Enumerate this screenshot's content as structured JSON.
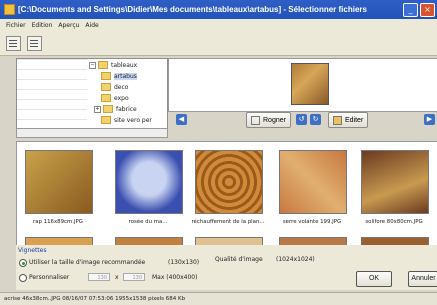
{
  "window": {
    "title": "[C:\\Documents and Settings\\Didier\\Mes documents\\tableaux\\artabus] - Sélectionner fichiers"
  },
  "menu": [
    "Fichier",
    "Edition",
    "Aperçu",
    "Aide"
  ],
  "tree": [
    {
      "label": "tableaux",
      "expander": "−"
    },
    {
      "label": "artabus"
    },
    {
      "label": "deco"
    },
    {
      "label": "expo"
    },
    {
      "label": "fabrice",
      "expander": "+"
    },
    {
      "label": "site vero per"
    }
  ],
  "actions": {
    "rogner": "Rogner",
    "editer": "Editer"
  },
  "thumbnails": [
    {
      "caption": "rap 116x89cm.JPG",
      "colors": [
        "#c8a24a",
        "#8a5a20"
      ]
    },
    {
      "caption": "rosée du ma...",
      "colors": [
        "#3a4fb0",
        "#c9d4f2"
      ]
    },
    {
      "caption": "réchauffement de la plan...",
      "colors": [
        "#d08a3a",
        "#9a5a1a"
      ]
    },
    {
      "caption": "serre volante 199.JPG",
      "colors": [
        "#c87840",
        "#e0b070"
      ]
    },
    {
      "caption": "solifore 80x80cm.JPG",
      "colors": [
        "#6a3a20",
        "#c89a50"
      ]
    }
  ],
  "vignettes": {
    "group_label": "Vignettes",
    "option1": "Utiliser la taille d'image recommandée",
    "option1_size": "(130x130)",
    "option2": "Personnaliser",
    "width": "130",
    "x": "x",
    "height": "130",
    "max": "Max (400x400)"
  },
  "quality": {
    "label": "Qualité d'image",
    "value": "(1024x1024)"
  },
  "buttons": {
    "ok": "OK",
    "cancel": "Annuler"
  },
  "status": "acrise 46x38cm..JPG  08/16/07 07:53:06   1955x1538 pixels   684 Kb"
}
